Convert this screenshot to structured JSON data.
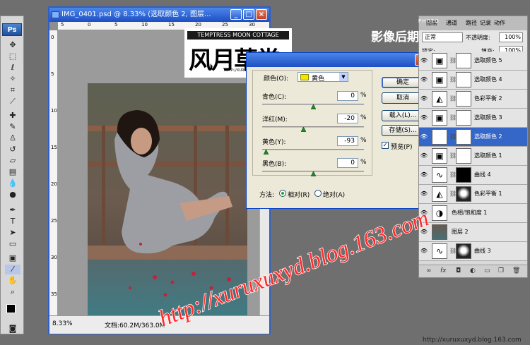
{
  "app": {
    "name": "Ps"
  },
  "document": {
    "title": "IMG_0401.psd @ 8.33% (选取颜色 2, 图层...",
    "zoom": "8.33%",
    "doc_size": "文档:60.2M/363.0M",
    "ruler_top": [
      "5",
      "0",
      "5",
      "10",
      "15",
      "20",
      "25",
      "30"
    ],
    "ruler_left": [
      "0",
      "5",
      "10",
      "15",
      "20",
      "25",
      "30",
      "35"
    ]
  },
  "logo": {
    "top_text": "TEMPTRESS MOON COTTAGE",
    "main_text": "风月草堂",
    "url": "HTTP://XURUXUXYD.BLOG.163.COM"
  },
  "dialog": {
    "colors_label": "颜色(O):",
    "selected_color": "黄色",
    "selected_color_swatch": "#f5e600",
    "sliders": [
      {
        "label": "青色(C):",
        "value": "0",
        "position": 0.5
      },
      {
        "label": "洋红(M):",
        "value": "-20",
        "position": 0.4
      },
      {
        "label": "黄色(Y):",
        "value": "-93",
        "position": 0.035
      },
      {
        "label": "黑色(B):",
        "value": "0",
        "position": 0.5
      }
    ],
    "percent_sign": "%",
    "buttons": {
      "ok": "确定",
      "cancel": "取消",
      "load": "载入(L)...",
      "save": "存储(S)..."
    },
    "preview_label": "预览(P)",
    "preview_checked": true,
    "method_label": "方法:",
    "method_relative": "相对(R)",
    "method_absolute": "绝对(A)",
    "method_selected": "relative"
  },
  "layers_panel": {
    "tabs": [
      "图层",
      "通道",
      "路径",
      "记录",
      "动作"
    ],
    "blend_mode": "正常",
    "opacity_label": "不透明度:",
    "opacity_value": "100%",
    "lock_label": "锁定:",
    "fill_label": "填充:",
    "fill_value": "100%",
    "layers": [
      {
        "name": "选取颜色 5",
        "type": "adjust",
        "selected": false,
        "mask": "white"
      },
      {
        "name": "选取颜色 4",
        "type": "adjust",
        "selected": false,
        "mask": "white"
      },
      {
        "name": "色彩平衡 2",
        "type": "balance",
        "selected": false,
        "mask": "white"
      },
      {
        "name": "选取颜色 3",
        "type": "adjust",
        "selected": false,
        "mask": "white"
      },
      {
        "name": "选取颜色 2",
        "type": "adjust",
        "selected": true,
        "mask": "white"
      },
      {
        "name": "选取颜色 1",
        "type": "adjust",
        "selected": false,
        "mask": "white"
      },
      {
        "name": "曲线 4",
        "type": "curves",
        "selected": false,
        "mask": "black"
      },
      {
        "name": "色彩平衡 1",
        "type": "balance",
        "selected": false,
        "mask": "figure"
      },
      {
        "name": "色相/饱和度 1",
        "type": "hue",
        "selected": false,
        "mask": "none"
      },
      {
        "name": "图层 2",
        "type": "photo",
        "selected": false,
        "mask": "none"
      },
      {
        "name": "曲线 3",
        "type": "curves",
        "selected": false,
        "mask": "figure"
      }
    ]
  },
  "watermarks": {
    "blog_url": "http://xuruxuxyd.blog.163.com",
    "corner_brand": "影像后期",
    "corner_small": "PHOTO",
    "footer_url": "http://xuruxuxyd.blog.163.com"
  }
}
